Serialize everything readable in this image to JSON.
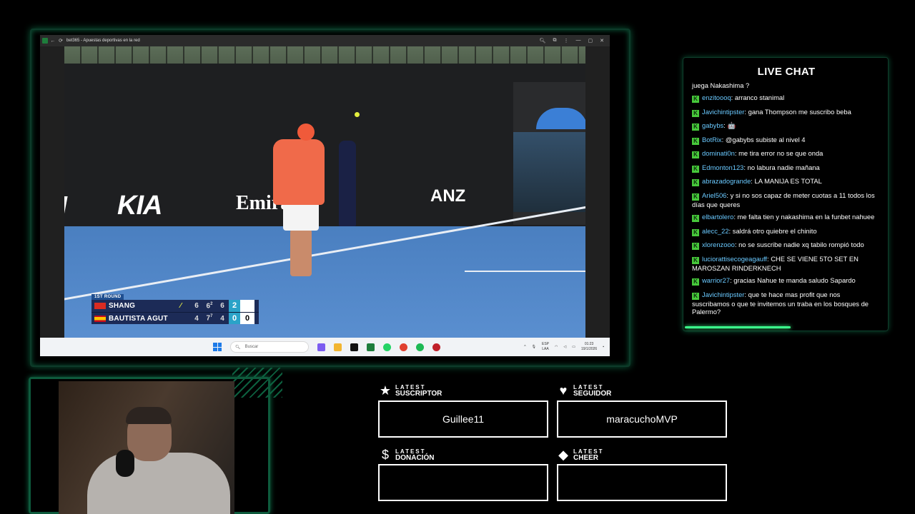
{
  "browser": {
    "window_title": "bet365 - Apuestas deportivas en la red",
    "search": {
      "placeholder": "Buscar"
    },
    "tray": {
      "lang_line1": "ESP",
      "lang_line2": "LAA",
      "time": "01:23",
      "date": "19/1/2026"
    }
  },
  "broadcast": {
    "sponsors": [
      "KIA",
      "Emirates",
      "ANZ"
    ],
    "round": "1ST ROUND",
    "players": [
      {
        "name": "SHANG",
        "flag": "china",
        "serving": true,
        "sets": [
          "6",
          "6",
          "6"
        ],
        "tiebreak_set2": "2",
        "current": "2",
        "points": ""
      },
      {
        "name": "BAUTISTA AGUT",
        "flag": "spain",
        "serving": false,
        "sets": [
          "4",
          "7",
          "4"
        ],
        "tiebreak_set2": "7",
        "current": "0",
        "points": "0"
      }
    ]
  },
  "chat": {
    "title": "LIVE CHAT",
    "partial_top": "juega Nakashima ?",
    "messages": [
      {
        "user": "enzitoooq",
        "text": "arranco stanimal"
      },
      {
        "user": "Javichintipster",
        "text": "gana Thompson me suscribo beba"
      },
      {
        "user": "gabybs",
        "text": "🤖"
      },
      {
        "user": "BotRix",
        "text": "@gabybs subiste al nivel 4"
      },
      {
        "user": "dominati0n",
        "text": "me tira error no se que onda"
      },
      {
        "user": "Edmonton123",
        "text": "no labura nadie mañana"
      },
      {
        "user": "abrazadogrande",
        "text": "LA MANIJA ES TOTAL"
      },
      {
        "user": "Ariel506",
        "text": "y si no sos capaz de meter cuotas a 11 todos los días que queres"
      },
      {
        "user": "elbartolero",
        "text": "me falta tien y nakashima en la funbet nahuee"
      },
      {
        "user": "alecc_22",
        "text": "saldrá otro quiebre el chinito"
      },
      {
        "user": "xlorenzooo",
        "text": "no se suscribe nadie xq tabilo rompió todo"
      },
      {
        "user": "luciorattisecogeagauff",
        "text": "CHE SE VIENE 5TO SET EN MAROSZAN RINDERKNECH"
      },
      {
        "user": "warrior27",
        "text": "gracias Nahue te manda saludo Sapardo"
      },
      {
        "user": "Javichintipster",
        "text": "que te hace mas profit que nos suscribamos o que te invitemos un traba en los bosques de Palermo?"
      }
    ]
  },
  "alerts": {
    "suscriptor": {
      "label_small": "LATEST",
      "label_big": "SUSCRIPTOR",
      "icon": "star-icon",
      "value": "Guillee11"
    },
    "seguidor": {
      "label_small": "LATEST",
      "label_big": "SEGUIDOR",
      "icon": "heart-icon",
      "value": "maracuchoMVP"
    },
    "donacion": {
      "label_small": "LATEST",
      "label_big": "DONACIÓN",
      "icon": "dollar-icon",
      "value": ""
    },
    "cheer": {
      "label_small": "LATEST",
      "label_big": "CHEER",
      "icon": "diamond-icon",
      "value": ""
    }
  },
  "colors": {
    "accent": "#3cff8c",
    "frame": "#0e5a3c",
    "chat_user": "#6ac9ff",
    "badge": "#47c93b"
  }
}
